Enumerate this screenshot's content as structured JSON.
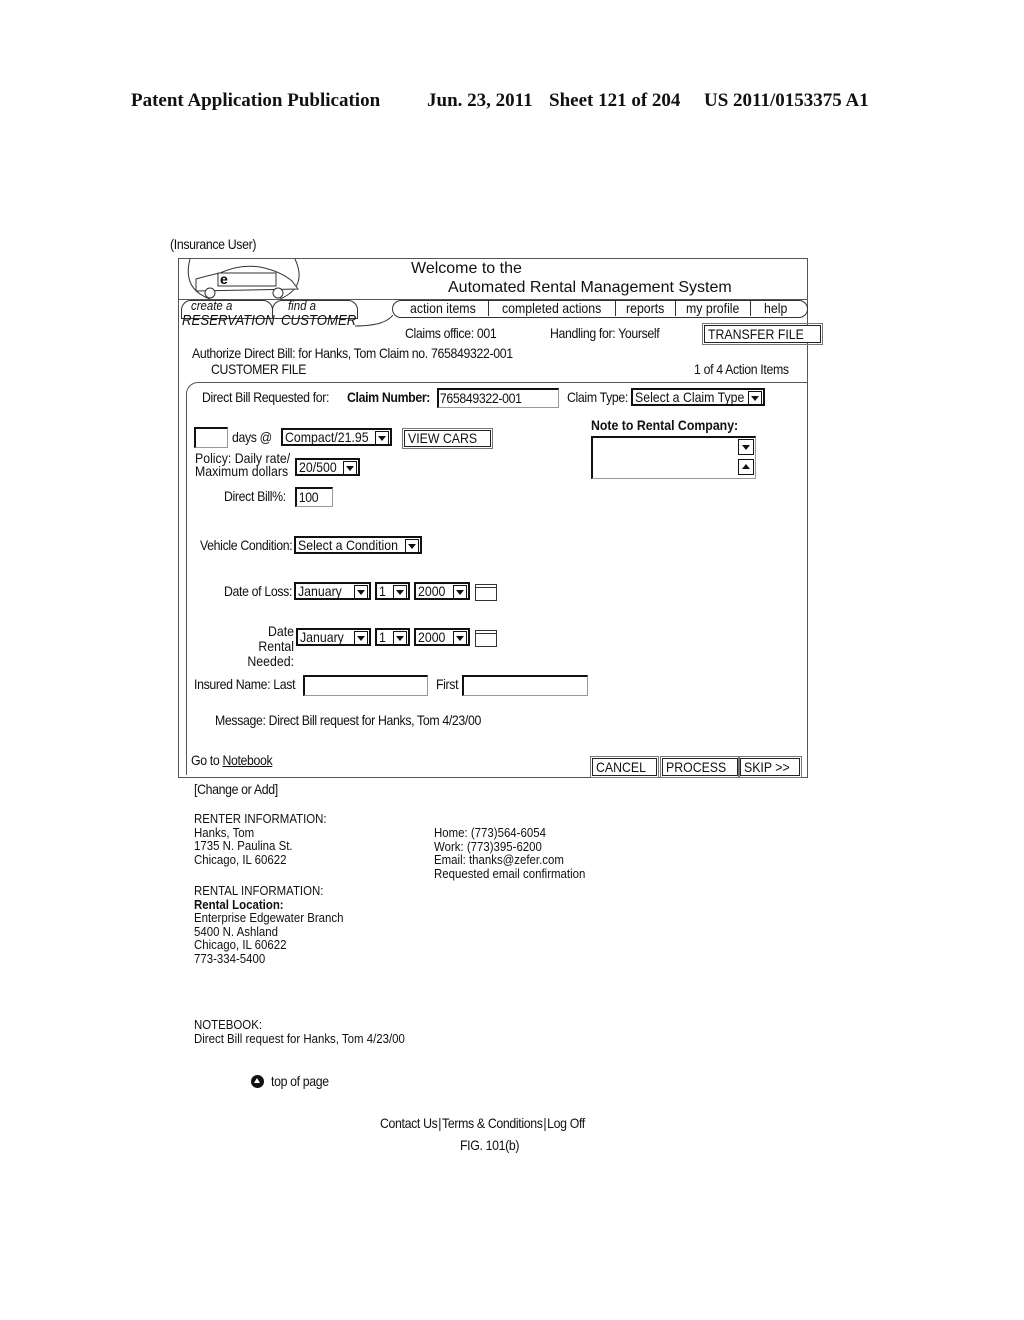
{
  "patent_header": {
    "publication": "Patent Application Publication",
    "date": "Jun. 23, 2011",
    "sheet": "Sheet 121 of 204",
    "number": "US 2011/0153375 A1"
  },
  "user_role": "(Insurance User)",
  "banner": {
    "logo_letter": "e",
    "welcome_line1": "Welcome to the",
    "welcome_line2": "Automated Rental Management System"
  },
  "tabs": [
    {
      "small": "create a",
      "large": "RESERVATION"
    },
    {
      "small": "find a",
      "large": "CUSTOMER"
    }
  ],
  "nav": [
    "action items",
    "completed actions",
    "reports",
    "my profile",
    "help"
  ],
  "status": {
    "claims_office": "Claims office: 001",
    "handling_for": "Handling for: Yourself",
    "transfer_button": "TRANSFER FILE"
  },
  "file_header": {
    "authorize": "Authorize Direct Bill: for Hanks, Tom  Claim no. 765849322-001",
    "customer_file": "CUSTOMER FILE",
    "action_count": "1 of 4 Action Items"
  },
  "form": {
    "direct_bill_label": "Direct Bill Requested for:",
    "claim_number_label": "Claim Number:",
    "claim_number_value": "765849322-001",
    "claim_type_label": "Claim Type:",
    "claim_type_value": "Select a Claim Type",
    "note_label": "Note to Rental Company:",
    "note_value": "",
    "days_value": "",
    "days_label": "days @",
    "car_class_value": "Compact/21.95",
    "view_cars_button": "VIEW CARS",
    "policy_label_1": "Policy: Daily rate/",
    "policy_label_2": "Maximum dollars",
    "policy_value": "20/500",
    "direct_bill_pct_label": "Direct Bill%:",
    "direct_bill_pct_value": "100",
    "vehicle_condition_label": "Vehicle Condition:",
    "vehicle_condition_value": "Select a Condition",
    "date_of_loss_label": "Date of Loss:",
    "date_of_loss": {
      "month": "January",
      "day": "1",
      "year": "2000"
    },
    "date_needed_label_1": "Date Rental",
    "date_needed_label_2": "Needed:",
    "date_needed": {
      "month": "January",
      "day": "1",
      "year": "2000"
    },
    "insured_name_label": "Insured Name:  Last",
    "insured_last_value": "",
    "first_label": "First",
    "insured_first_value": "",
    "message": "Message: Direct Bill request for Hanks, Tom 4/23/00",
    "goto_prefix": "Go to ",
    "goto_link": "Notebook",
    "cancel_button": "CANCEL",
    "process_button": "PROCESS",
    "skip_button": "SKIP >>"
  },
  "change_or_add": "[Change or Add]",
  "renter": {
    "heading": "RENTER INFORMATION:",
    "name": "Hanks, Tom",
    "street": "1735 N. Paulina St.",
    "city": "Chicago, IL 60622",
    "home": "Home: (773)564-6054",
    "work": "Work: (773)395-6200",
    "email": "Email: thanks@zefer.com",
    "confirmation": "Requested email confirmation"
  },
  "rental": {
    "heading": "RENTAL INFORMATION:",
    "location_label": "Rental Location:",
    "branch": "Enterprise Edgewater Branch",
    "street": "5400 N. Ashland",
    "city": "Chicago, IL 60622",
    "phone": "773-334-5400"
  },
  "notebook": {
    "heading": "NOTEBOOK:",
    "entry": "Direct Bill request for Hanks, Tom 4/23/00"
  },
  "top_of_page": "top of page",
  "footer_links": [
    "Contact Us",
    "Terms & Conditions",
    "Log Off"
  ],
  "figure_label": "FIG. 101(b)"
}
